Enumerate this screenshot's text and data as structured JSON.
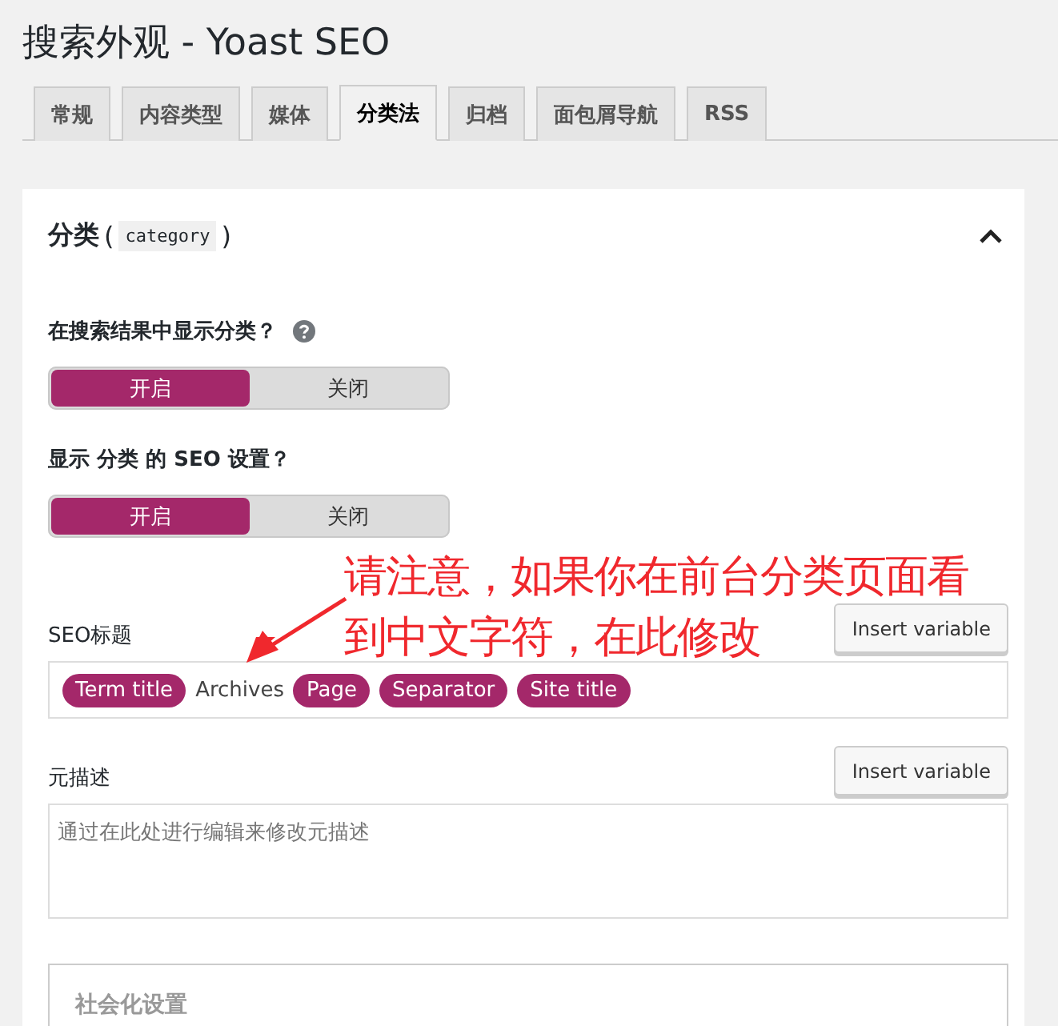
{
  "page_title": "搜索外观 - Yoast SEO",
  "tabs": [
    {
      "label": "常规",
      "selected": false
    },
    {
      "label": "内容类型",
      "selected": false
    },
    {
      "label": "媒体",
      "selected": false
    },
    {
      "label": "分类法",
      "selected": true
    },
    {
      "label": "归档",
      "selected": false
    },
    {
      "label": "面包屑导航",
      "selected": false
    },
    {
      "label": "RSS",
      "selected": false
    }
  ],
  "section": {
    "title": "分类",
    "slug": "category",
    "open_paren": "(",
    "close_paren": ")",
    "expanded": true,
    "settings": [
      {
        "label": "在搜索结果中显示分类？",
        "help": true,
        "options": [
          {
            "label": "开启",
            "selected": true
          },
          {
            "label": "关闭",
            "selected": false
          }
        ]
      },
      {
        "label": "显示 分类 的 SEO 设置？",
        "help": false,
        "options": [
          {
            "label": "开启",
            "selected": true
          },
          {
            "label": "关闭",
            "selected": false
          }
        ]
      }
    ],
    "seo_title": {
      "label": "SEO标题",
      "button": "Insert variable",
      "parts": [
        {
          "kind": "variable",
          "text": "Term title"
        },
        {
          "kind": "text",
          "text": "Archives"
        },
        {
          "kind": "variable",
          "text": "Page"
        },
        {
          "kind": "variable",
          "text": "Separator"
        },
        {
          "kind": "variable",
          "text": "Site title"
        }
      ]
    },
    "meta_description": {
      "label": "元描述",
      "button": "Insert variable",
      "placeholder": "通过在此处进行编辑来修改元描述"
    },
    "social": {
      "title": "社会化设置"
    }
  },
  "annotation": {
    "lines": [
      "请注意，如果你在前台分类页面看",
      "到中文字符，在此修改"
    ]
  }
}
